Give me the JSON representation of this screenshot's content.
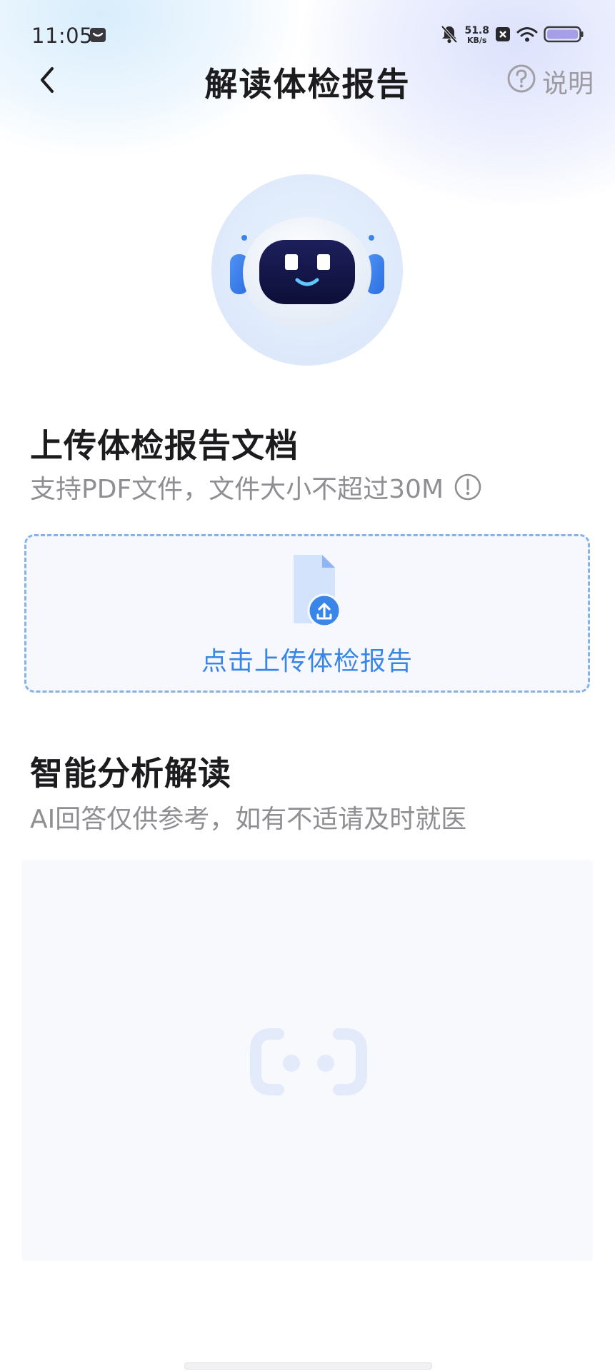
{
  "status_bar": {
    "time": "11:05",
    "net_speed_value": "51.8",
    "net_speed_unit": "KB/s",
    "icons": [
      "message-icon",
      "mute-bell-icon",
      "blocked-icon",
      "wifi-icon",
      "battery-icon"
    ]
  },
  "nav": {
    "title": "解读体检报告",
    "help_label": "说明",
    "back_icon": "chevron-left-icon",
    "help_icon": "question-circle-icon"
  },
  "avatar": {
    "icon": "robot-assistant-icon"
  },
  "upload_section": {
    "title": "上传体检报告文档",
    "subtitle": "支持PDF文件，文件大小不超过30M",
    "info_icon": "info-circle-icon",
    "upload_label": "点击上传体检报告",
    "upload_icon": "file-upload-icon"
  },
  "analysis_section": {
    "title": "智能分析解读",
    "subtitle": "AI回答仅供参考，如有不适请及时就医",
    "placeholder_icon": "robot-face-placeholder-icon"
  },
  "colors": {
    "accent": "#3a86e8",
    "dashed_border": "#86b2ea",
    "upload_bg": "#f6f8fd",
    "panel_bg": "#f8f9fd",
    "subtitle_gray": "#8e8e93"
  }
}
